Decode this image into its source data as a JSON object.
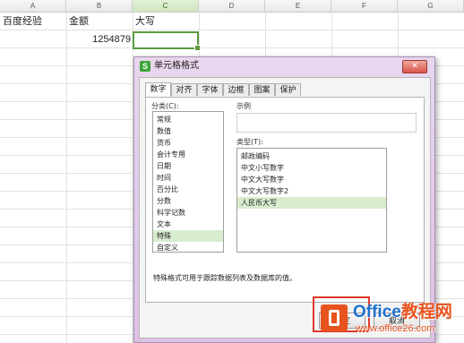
{
  "spreadsheet": {
    "columns": [
      "A",
      "B",
      "C",
      "D",
      "E",
      "F",
      "G"
    ],
    "active_column": "C",
    "cells": {
      "A1": "百度经验",
      "B1": "金额",
      "C1": "大写",
      "B2": "1254879"
    }
  },
  "dialog": {
    "title": "单元格格式",
    "close_label": "✕",
    "tabs": [
      "数字",
      "对齐",
      "字体",
      "边框",
      "图案",
      "保护"
    ],
    "active_tab": "数字",
    "category_label": "分类(C):",
    "categories": [
      "常规",
      "数值",
      "货币",
      "会计专用",
      "日期",
      "时间",
      "百分比",
      "分数",
      "科学记数",
      "文本",
      "特殊",
      "自定义"
    ],
    "selected_category": "特殊",
    "sample_label": "示例",
    "type_label": "类型(T):",
    "types": [
      "邮政编码",
      "中文小写数字",
      "中文大写数字",
      "中文大写数字2",
      "人民币大写"
    ],
    "selected_type": "人民币大写",
    "hint": "特殊格式可用于跟踪数据列表及数据库的值。",
    "ok_label": "确定",
    "cancel_label": "取消"
  },
  "watermark": {
    "brand_en": "Office",
    "brand_cn": "教程网",
    "url": "www.office26.com"
  },
  "colors": {
    "accent_green": "#5a9a3f",
    "dialog_frame": "#dcc2e4",
    "highlight_red": "#e03a2b",
    "watermark_orange": "#e8541e",
    "watermark_blue": "#1f6fcc"
  }
}
